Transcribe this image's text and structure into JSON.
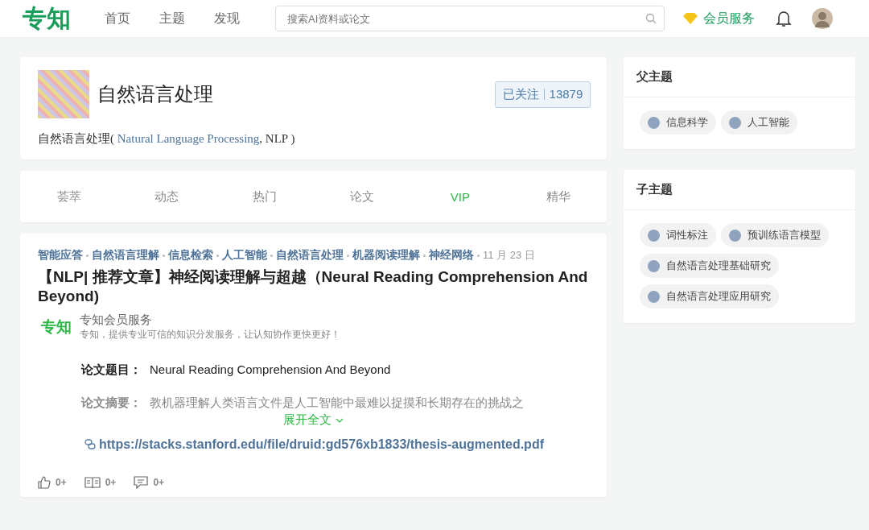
{
  "header": {
    "logo": "专知",
    "nav": [
      {
        "label": "首页",
        "selected": false
      },
      {
        "label": "主题",
        "selected": false
      },
      {
        "label": "发现",
        "selected": false
      }
    ],
    "search": {
      "placeholder": "搜索AI资料或论文"
    },
    "membership": "会员服务"
  },
  "topic": {
    "name": "自然语言处理",
    "follow": {
      "label": "已关注",
      "count": "13879"
    },
    "description": {
      "prefix": "自然语言处理(",
      "english": " Natural Language Processing",
      "suffix": ", NLP )"
    }
  },
  "tabs": [
    {
      "label": "荟萃",
      "selected": false
    },
    {
      "label": "动态",
      "selected": false
    },
    {
      "label": "热门",
      "selected": false
    },
    {
      "label": "论文",
      "selected": false
    },
    {
      "label": "VIP",
      "selected": true
    },
    {
      "label": "精华",
      "selected": false
    }
  ],
  "post": {
    "tags": [
      "智能应答",
      "自然语言理解",
      "信息检索",
      "人工智能",
      "自然语言处理",
      "机器阅读理解",
      "神经网络"
    ],
    "date": "11 月 23 日",
    "title": "【NLP| 推荐文章】神经阅读理解与超越（Neural Reading Comprehension And Beyond)",
    "source": {
      "logo": "专知",
      "name": "专知会员服务",
      "slogan": "专知，提供专业可信的知识分发服务，让认知协作更快更好！"
    },
    "paper_title": {
      "label": "论文题目：",
      "value": "Neural Reading Comprehension And Beyond"
    },
    "abstract": {
      "label": "论文摘要：",
      "value": "教机器理解人类语言文件是人工智能中最难以捉摸和长期存在的挑战之"
    },
    "expand": "展开全文",
    "link": "https://stacks.stanford.edu/file/druid:gd576xb1833/thesis-augmented.pdf",
    "stats": [
      {
        "kind": "like",
        "count": "0+"
      },
      {
        "kind": "read",
        "count": "0+"
      },
      {
        "kind": "comment",
        "count": "0+"
      }
    ]
  },
  "parent_topics": {
    "title": "父主题",
    "items": [
      "信息科学",
      "人工智能"
    ]
  },
  "child_topics": {
    "title": "子主题",
    "items": [
      "词性标注",
      "预训练语言模型",
      "自然语言处理基础研究",
      "自然语言处理应用研究"
    ]
  }
}
